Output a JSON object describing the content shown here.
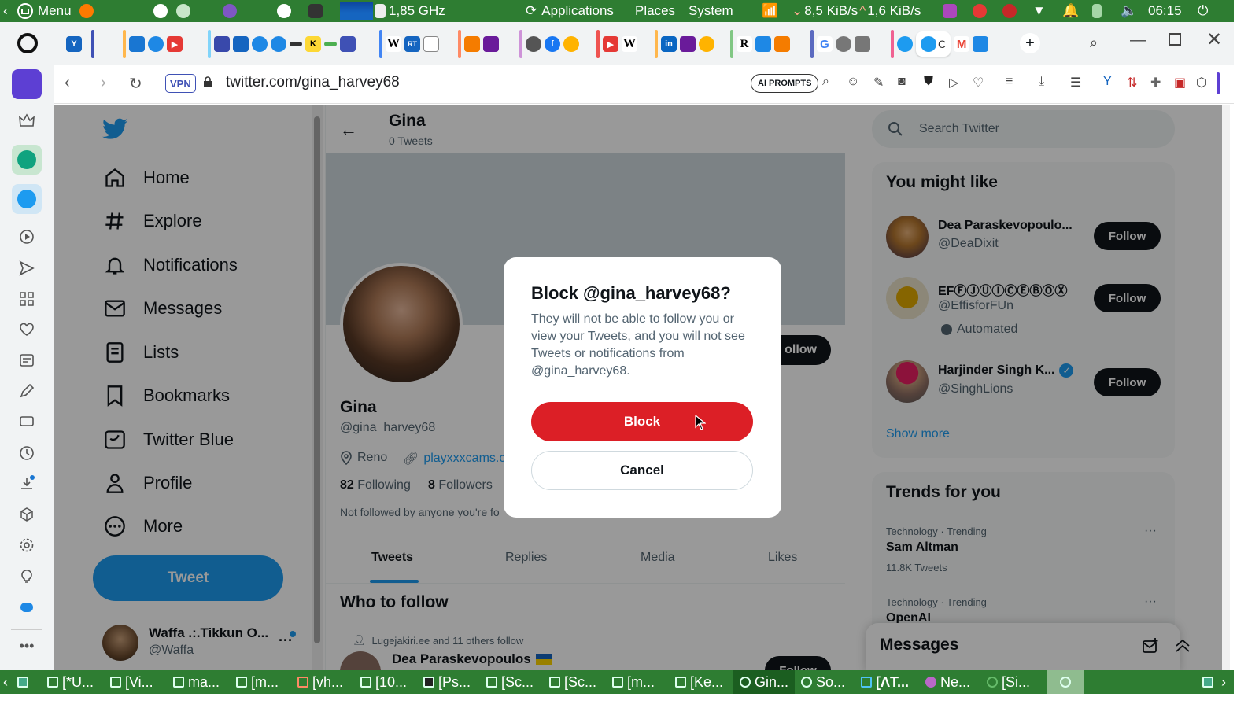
{
  "system_bar": {
    "menu_label": "Menu",
    "cpu_freq": "1,85 GHz",
    "applications_label": "Applications",
    "places_label": "Places",
    "system_label": "System",
    "net_down": "8,5 KiB/s",
    "net_up": "1,6 KiB/s",
    "clock": "06:15"
  },
  "browser": {
    "url": "twitter.com/gina_harvey68",
    "vpn_label": "VPN",
    "ai_prompts_label": "AI PROMPTS",
    "tab_favicon_letters": [
      "W",
      "RT",
      "K",
      "W",
      "in",
      "R",
      "G",
      "M"
    ]
  },
  "twitter": {
    "nav": [
      {
        "label": "Home"
      },
      {
        "label": "Explore"
      },
      {
        "label": "Notifications"
      },
      {
        "label": "Messages"
      },
      {
        "label": "Lists"
      },
      {
        "label": "Bookmarks"
      },
      {
        "label": "Twitter Blue"
      },
      {
        "label": "Profile"
      },
      {
        "label": "More"
      }
    ],
    "tweet_button": "Tweet",
    "account": {
      "name": "Waffa .:.Tikkun O...",
      "handle": "@Waffa"
    },
    "header": {
      "name": "Gina",
      "tweets": "0 Tweets"
    },
    "profile": {
      "name": "Gina",
      "handle": "@gina_harvey68",
      "location": "Reno",
      "link": "playxxxcams.c",
      "following_count": "82",
      "following_label": "Following",
      "followers_count": "8",
      "followers_label": "Followers",
      "not_followed": "Not followed by anyone you're fo",
      "follow_btn": "ollow"
    },
    "tabs": [
      "Tweets",
      "Replies",
      "Media",
      "Likes"
    ],
    "who_to_follow": {
      "title": "Who to follow",
      "social_context": "Lugejakiri.ee and 11 others follow",
      "name": "Dea Paraskevopoulos",
      "follow": "Follow"
    },
    "search_placeholder": "Search Twitter",
    "you_might_like": {
      "title": "You might like",
      "items": [
        {
          "name": "Dea Paraskevopoulo...",
          "handle": "@DeaDixit",
          "follow": "Follow"
        },
        {
          "name": "EFⒻⒿⓊⒾⒸⒺⒷⓄⓍ",
          "handle": "@EffisforFUn",
          "follow": "Follow",
          "extra": "Automated"
        },
        {
          "name": "Harjinder Singh K...",
          "handle": "@SinghLions",
          "follow": "Follow"
        }
      ],
      "show_more": "Show more"
    },
    "trends": {
      "title": "Trends for you",
      "items": [
        {
          "context": "Technology · Trending",
          "name": "Sam Altman",
          "count": "11.8K Tweets"
        },
        {
          "context": "Technology · Trending",
          "name": "OpenAI"
        }
      ]
    },
    "messages_drawer": "Messages"
  },
  "modal": {
    "title": "Block @gina_harvey68?",
    "body": "They will not be able to follow you or view your Tweets, and you will not see Tweets or notifications from @gina_harvey68.",
    "block": "Block",
    "cancel": "Cancel"
  },
  "taskbar": {
    "items": [
      "[*U...",
      "[Vi...",
      "ma...",
      "[m...",
      "[vh...",
      "[10...",
      "[Ps...",
      "[Sc...",
      "[Sc...",
      "[m...",
      "[Ke...",
      "Gin...",
      "So...",
      "[ΛT...",
      "Ne...",
      "[Si..."
    ]
  },
  "colors": {
    "twitter_blue": "#1d9bf0",
    "block_red": "#dc1f26",
    "system_green": "#2e7d32"
  }
}
